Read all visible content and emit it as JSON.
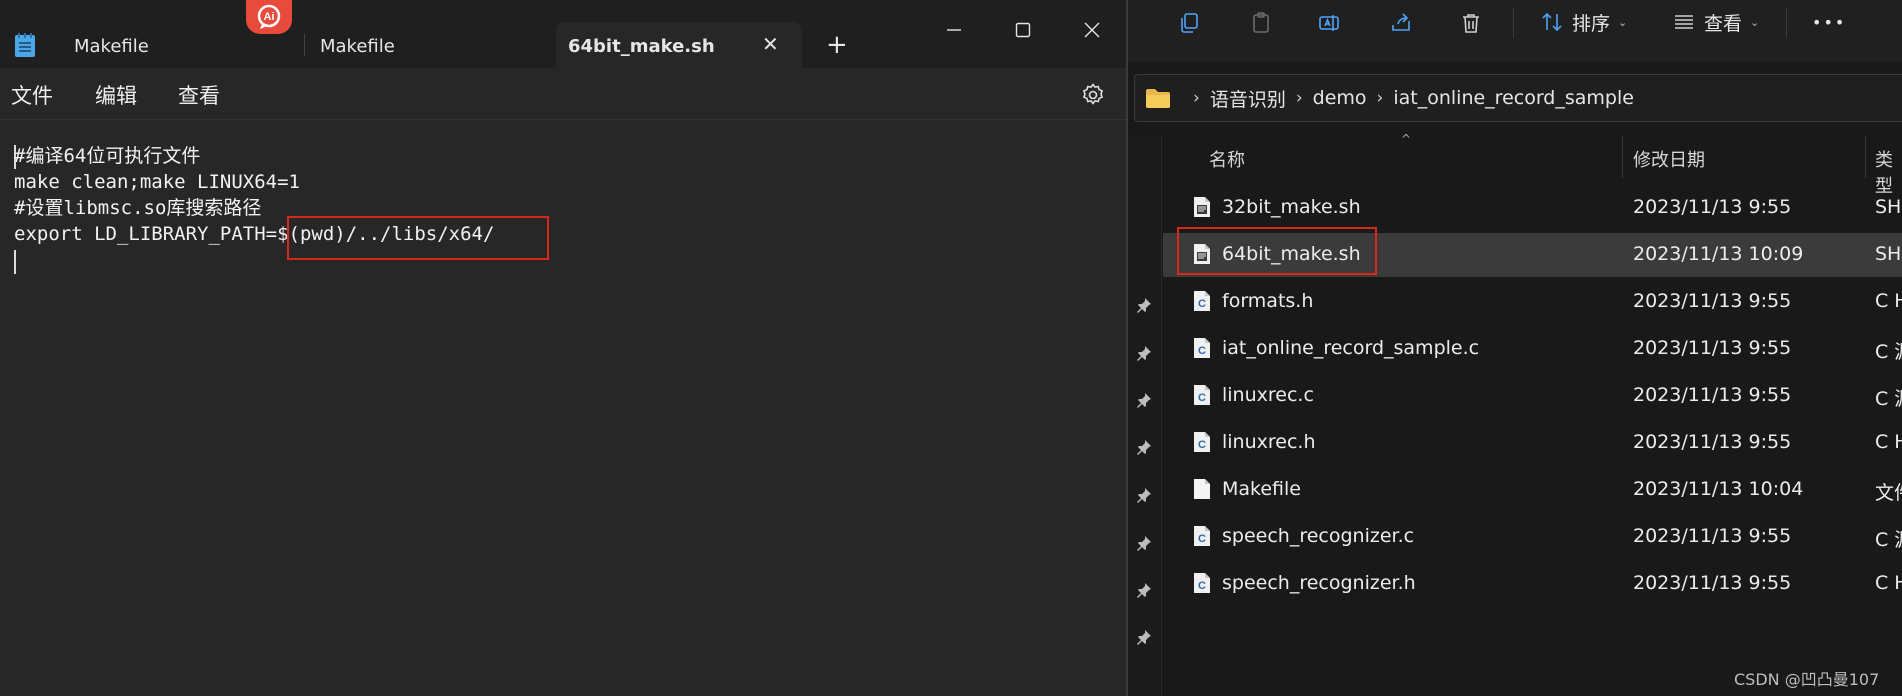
{
  "notepad": {
    "tabs": [
      {
        "label": "Makefile",
        "active": false
      },
      {
        "label": "Makefile",
        "active": false
      },
      {
        "label": "64bit_make.sh",
        "active": true
      }
    ],
    "new_tab_label": "+",
    "menu": [
      "文件",
      "编辑",
      "查看"
    ],
    "ai_badge_label": "Ai",
    "code_lines": [
      "#编译64位可执行文件",
      "make clean;make LINUX64=1",
      "#设置libmsc.so库搜索路径",
      "export LD_LIBRARY_PATH=$(pwd)/../libs/x64/"
    ]
  },
  "explorer": {
    "toolbar": {
      "sort_label": "排序",
      "view_label": "查看",
      "more_label": "•••"
    },
    "breadcrumb": [
      "语音识别",
      "demo",
      "iat_online_record_sample"
    ],
    "columns": {
      "name": "名称",
      "date": "修改日期",
      "type": "类型"
    },
    "files": [
      {
        "name": "32bit_make.sh",
        "date": "2023/11/13 9:55",
        "type": "SH",
        "icon": "script-file-icon"
      },
      {
        "name": "64bit_make.sh",
        "date": "2023/11/13 10:09",
        "type": "SH",
        "icon": "script-file-icon",
        "selected": true
      },
      {
        "name": "formats.h",
        "date": "2023/11/13 9:55",
        "type": "C H",
        "icon": "c-file-icon"
      },
      {
        "name": "iat_online_record_sample.c",
        "date": "2023/11/13 9:55",
        "type": "C 源",
        "icon": "c-file-icon"
      },
      {
        "name": "linuxrec.c",
        "date": "2023/11/13 9:55",
        "type": "C 源",
        "icon": "c-file-icon"
      },
      {
        "name": "linuxrec.h",
        "date": "2023/11/13 9:55",
        "type": "C H",
        "icon": "c-file-icon"
      },
      {
        "name": "Makefile",
        "date": "2023/11/13 10:04",
        "type": "文件",
        "icon": "blank-file-icon"
      },
      {
        "name": "speech_recognizer.c",
        "date": "2023/11/13 9:55",
        "type": "C 源",
        "icon": "c-file-icon"
      },
      {
        "name": "speech_recognizer.h",
        "date": "2023/11/13 9:55",
        "type": "C H",
        "icon": "c-file-icon"
      }
    ]
  },
  "watermark": "CSDN @凹凸曼107",
  "colors": {
    "highlight_box": "#d6291c",
    "ai_badge": "#e84a3c",
    "folder": "#e8b84a"
  }
}
